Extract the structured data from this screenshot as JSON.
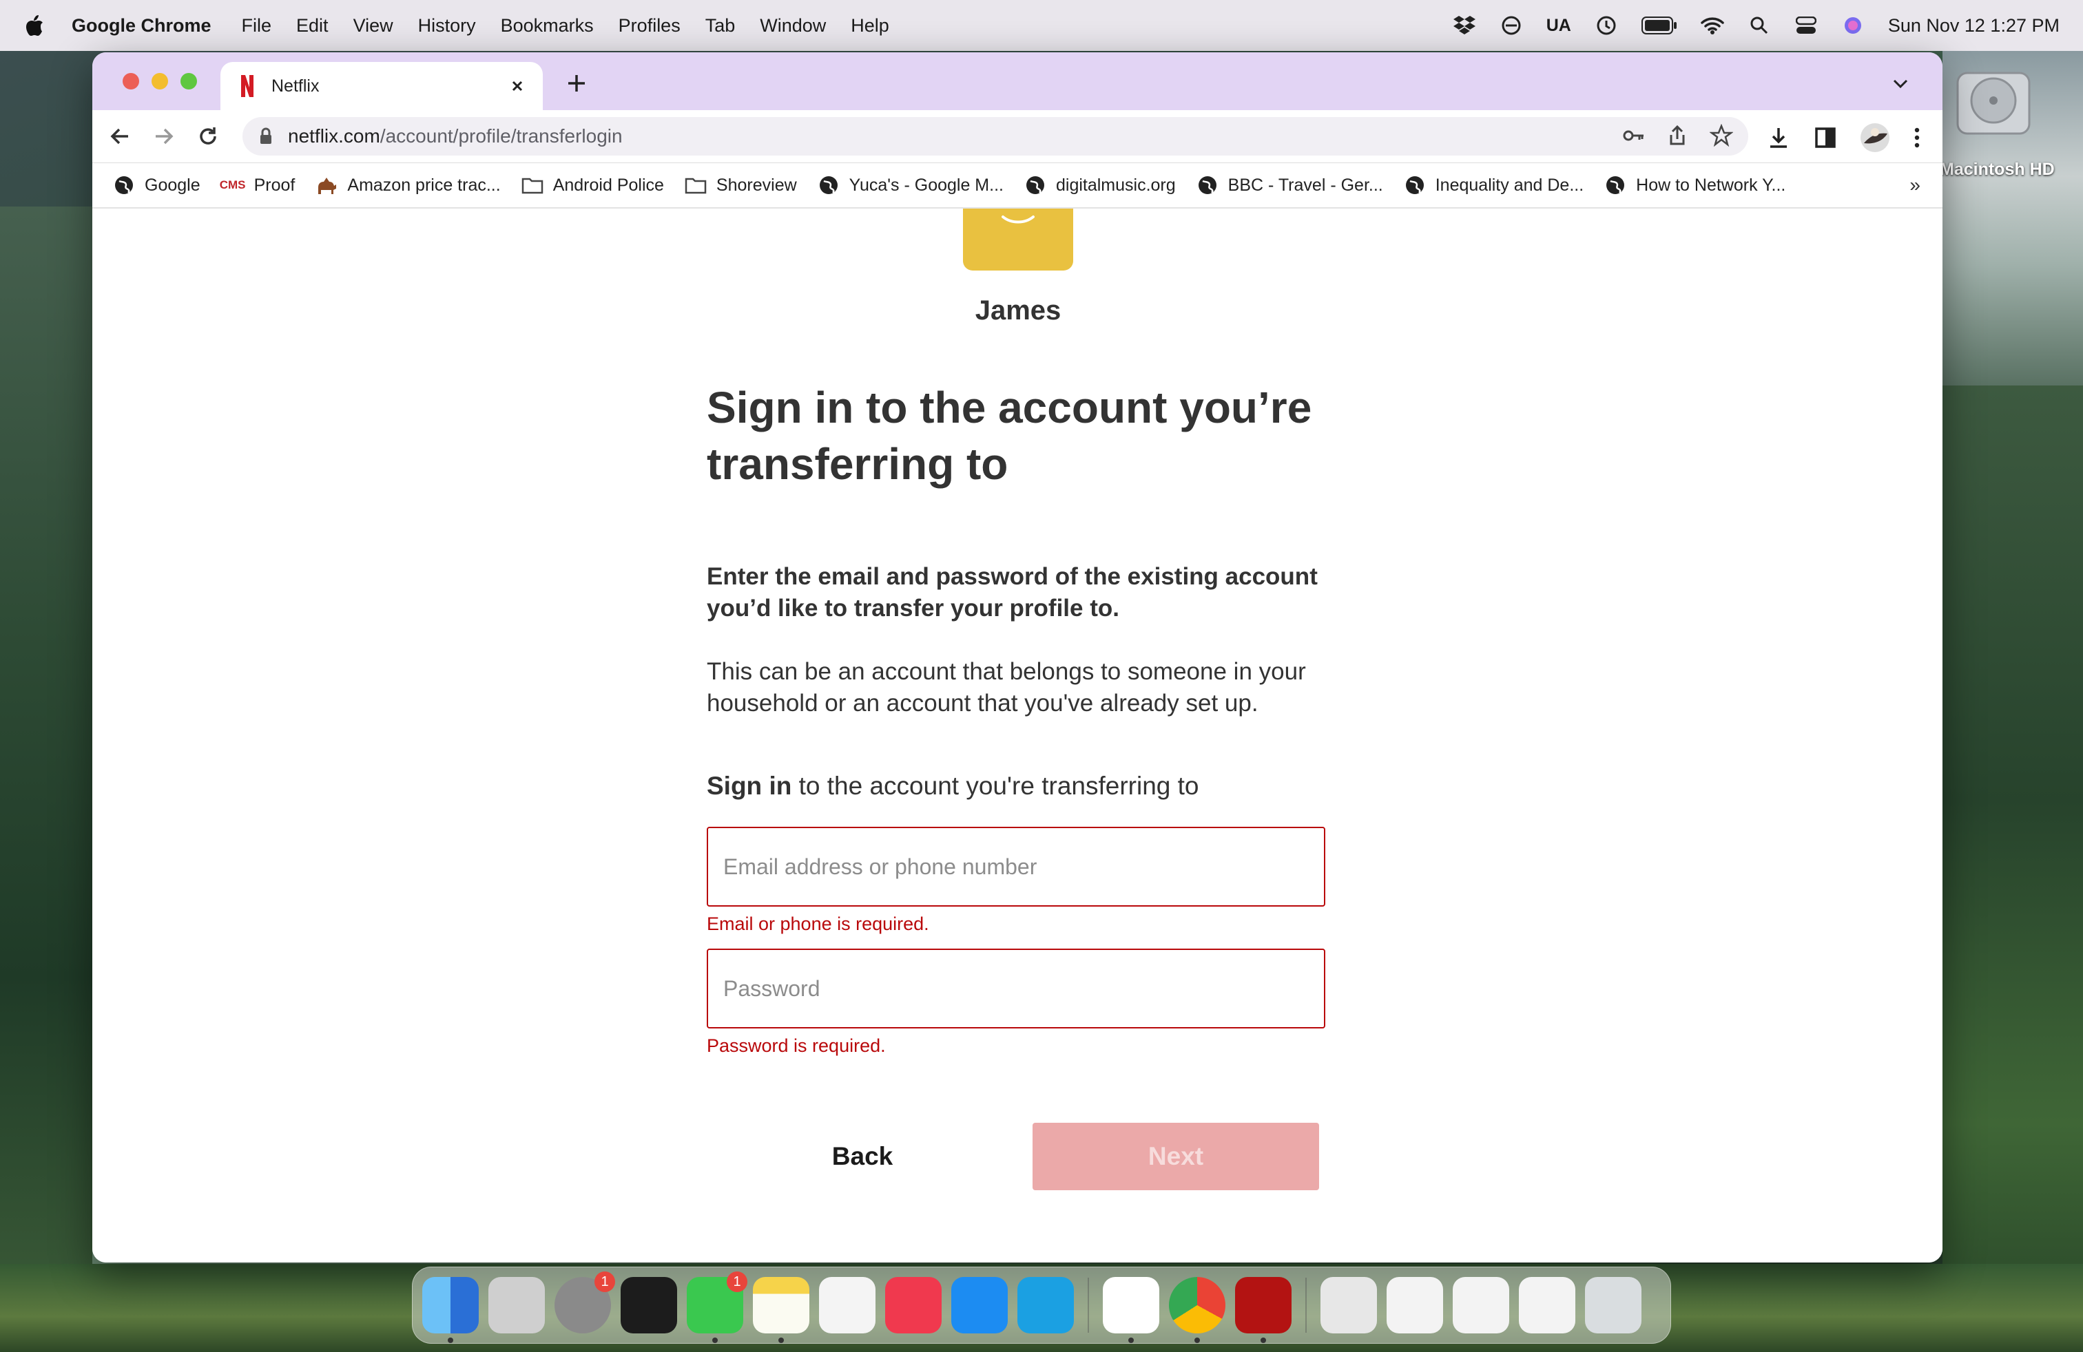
{
  "menubar": {
    "app_name": "Google Chrome",
    "menus": [
      "File",
      "Edit",
      "View",
      "History",
      "Bookmarks",
      "Profiles",
      "Tab",
      "Window",
      "Help"
    ],
    "status_text": "UA",
    "clock": "Sun Nov 12  1:27 PM"
  },
  "browser": {
    "tab_title": "Netflix",
    "url_host": "netflix.com",
    "url_path": "/account/profile/transferlogin",
    "bookmarks": [
      {
        "label": "Google",
        "icon": "globe-icon"
      },
      {
        "label": "Proof",
        "icon": "cms-icon"
      },
      {
        "label": "Amazon price trac...",
        "icon": "camel-icon"
      },
      {
        "label": "Android Police",
        "icon": "folder-icon"
      },
      {
        "label": "Shoreview",
        "icon": "folder-icon"
      },
      {
        "label": "Yuca's - Google M...",
        "icon": "globe-icon"
      },
      {
        "label": "digitalmusic.org",
        "icon": "globe-icon"
      },
      {
        "label": "BBC - Travel - Ger...",
        "icon": "globe-icon"
      },
      {
        "label": "Inequality and De...",
        "icon": "globe-icon"
      },
      {
        "label": "How to Network Y...",
        "icon": "globe-icon"
      }
    ],
    "bookmarks_more": "»"
  },
  "page": {
    "profile_name": "James",
    "heading": "Sign in to the account you’re transferring to",
    "subheading_bold": "Enter the email and password of the existing account you’d like to transfer your profile to.",
    "subheading": "This can be an account that belongs to someone in your household or an account that you've already set up.",
    "signin_bold": "Sign in",
    "signin_rest": " to the account you're transferring to",
    "email": {
      "placeholder": "Email address or phone number",
      "value": "",
      "error": "Email or phone is required."
    },
    "password": {
      "placeholder": "Password",
      "value": "",
      "error": "Password is required."
    },
    "back_label": "Back",
    "next_label": "Next"
  },
  "desktop": {
    "disk_label": "Macintosh HD"
  },
  "dock": {
    "apps": [
      {
        "name": "finder-icon",
        "color": "#2c8ef0"
      },
      {
        "name": "launchpad-icon",
        "color": "#c9c9c9"
      },
      {
        "name": "system-settings-icon",
        "color": "#8a8a8a",
        "badge": "1"
      },
      {
        "name": "mosaic-icon",
        "color": "#1c1c1c"
      },
      {
        "name": "messages-icon",
        "color": "#3ac84f",
        "badge": "1"
      },
      {
        "name": "notes-icon",
        "color": "#f6d34a"
      },
      {
        "name": "freeform-icon",
        "color": "#f4f4f4"
      },
      {
        "name": "music-icon",
        "color": "#f0394e"
      },
      {
        "name": "app-store-icon",
        "color": "#1c8cf2"
      },
      {
        "name": "skype-icon",
        "color": "#1ba0e2"
      },
      {
        "name": "slack-icon",
        "color": "#ffffff"
      },
      {
        "name": "chrome-icon",
        "color": "#ffffff"
      },
      {
        "name": "acrobat-icon",
        "color": "#b31312"
      },
      {
        "name": "archive-icon",
        "color": "#e7e7e7"
      },
      {
        "name": "sheet-doc-icon",
        "color": "#f3f3f3"
      },
      {
        "name": "doc-window-icon",
        "color": "#f3f3f3"
      },
      {
        "name": "doc-window-2-icon",
        "color": "#f3f3f3"
      },
      {
        "name": "trash-icon",
        "color": "#d9dde0"
      }
    ]
  }
}
